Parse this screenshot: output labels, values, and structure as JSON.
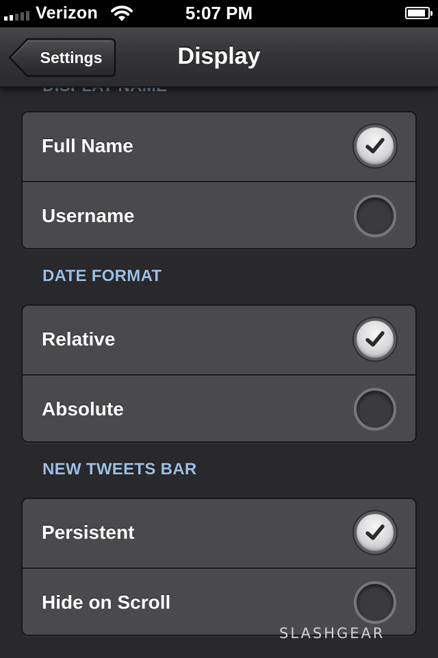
{
  "status_bar": {
    "carrier": "Verizon",
    "time": "5:07 PM",
    "signal_bars": 2,
    "battery_level": 0.88
  },
  "nav": {
    "back_label": "Settings",
    "title": "Display"
  },
  "sections": [
    {
      "header": "DISPLAY NAME",
      "options": [
        {
          "label": "Full Name",
          "selected": true
        },
        {
          "label": "Username",
          "selected": false
        }
      ]
    },
    {
      "header": "DATE FORMAT",
      "options": [
        {
          "label": "Relative",
          "selected": true
        },
        {
          "label": "Absolute",
          "selected": false
        }
      ]
    },
    {
      "header": "NEW TWEETS BAR",
      "options": [
        {
          "label": "Persistent",
          "selected": true
        },
        {
          "label": "Hide on Scroll",
          "selected": false
        }
      ]
    }
  ],
  "watermark": "SLASHGEAR",
  "colors": {
    "section_header": "#9cc0e6",
    "cell_background": "#4a4a4d",
    "page_background": "#29292b"
  }
}
